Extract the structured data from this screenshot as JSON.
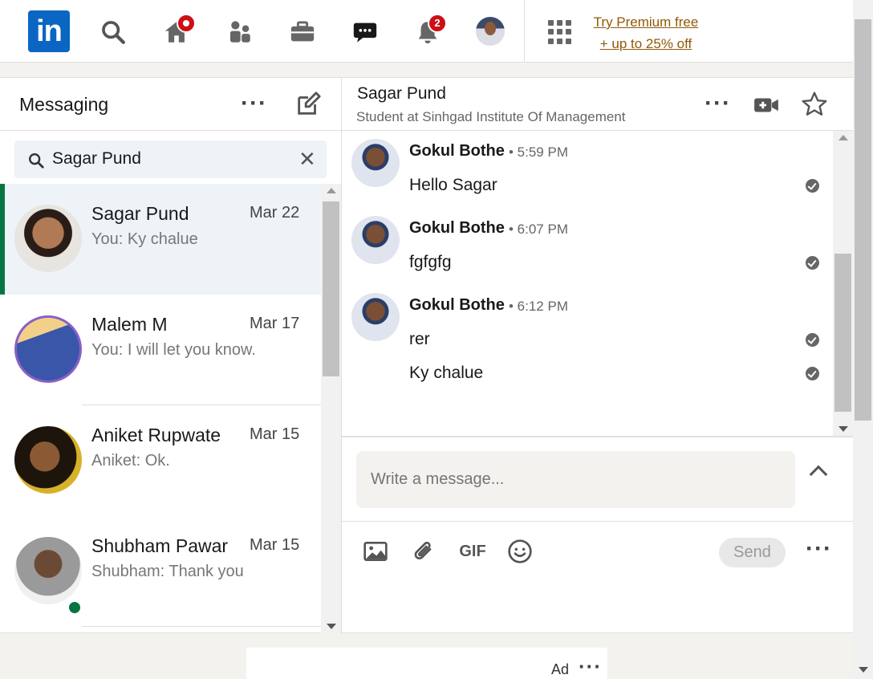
{
  "nav": {
    "logo": "in",
    "notification_count": "2",
    "premium_line1": "Try Premium free",
    "premium_line2": "+ up to 25% off"
  },
  "messaging": {
    "title": "Messaging",
    "search_value": "Sagar Pund",
    "conversations": [
      {
        "name": "Sagar Pund",
        "date": "Mar 22",
        "snippet": "You: Ky chalue"
      },
      {
        "name": "Malem M",
        "date": "Mar 17",
        "snippet": "You: I will let you know."
      },
      {
        "name": "Aniket Rupwate",
        "date": "Mar 15",
        "snippet": "Aniket: Ok."
      },
      {
        "name": "Shubham Pawar",
        "date": "Mar 15",
        "snippet": "Shubham: Thank you"
      }
    ]
  },
  "chat": {
    "name": "Sagar Pund",
    "headline": "Student at Sinhgad Institute Of Management",
    "groups": [
      {
        "sender": "Gokul Bothe",
        "time": "• 5:59 PM",
        "messages": [
          "Hello Sagar"
        ]
      },
      {
        "sender": "Gokul Bothe",
        "time": "• 6:07 PM",
        "messages": [
          "fgfgfg"
        ]
      },
      {
        "sender": "Gokul Bothe",
        "time": "• 6:12 PM",
        "messages": [
          "rer",
          "Ky chalue"
        ]
      }
    ],
    "compose_placeholder": "Write a message...",
    "gif_label": "GIF",
    "send_label": "Send"
  },
  "ad": {
    "label": "Ad"
  },
  "colors": {
    "brand": "#0a66c2",
    "active_bar": "#057642",
    "badge": "#cc1016",
    "premium": "#915907"
  }
}
